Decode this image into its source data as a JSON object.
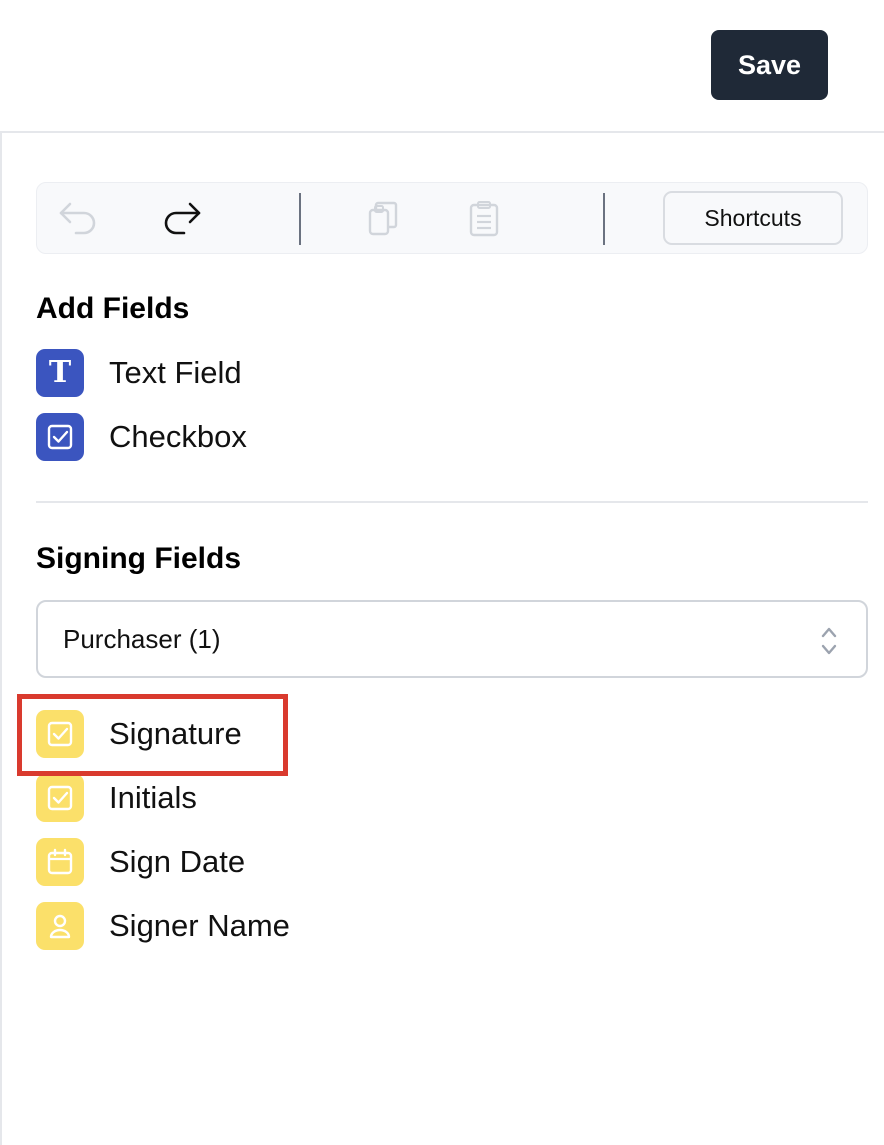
{
  "header": {
    "save_label": "Save"
  },
  "toolbar": {
    "undo_icon": "undo-icon",
    "redo_icon": "redo-icon",
    "copy_icon": "copy-icon",
    "paste_icon": "paste-icon",
    "shortcuts_label": "Shortcuts"
  },
  "add_fields": {
    "title": "Add Fields",
    "items": [
      {
        "label": "Text Field",
        "icon": "text-t-icon"
      },
      {
        "label": "Checkbox",
        "icon": "checkbox-icon"
      }
    ]
  },
  "signing_fields": {
    "title": "Signing Fields",
    "signer_select": {
      "value": "Purchaser (1)"
    },
    "items": [
      {
        "label": "Signature",
        "icon": "checkbox-icon"
      },
      {
        "label": "Initials",
        "icon": "checkbox-icon"
      },
      {
        "label": "Sign Date",
        "icon": "calendar-icon"
      },
      {
        "label": "Signer Name",
        "icon": "person-icon"
      }
    ]
  },
  "colors": {
    "save_bg": "#1f2937",
    "add_field_icon_bg": "#3b55bf",
    "signing_field_icon_bg": "#fbe06a",
    "highlight": "#d93a2e"
  }
}
